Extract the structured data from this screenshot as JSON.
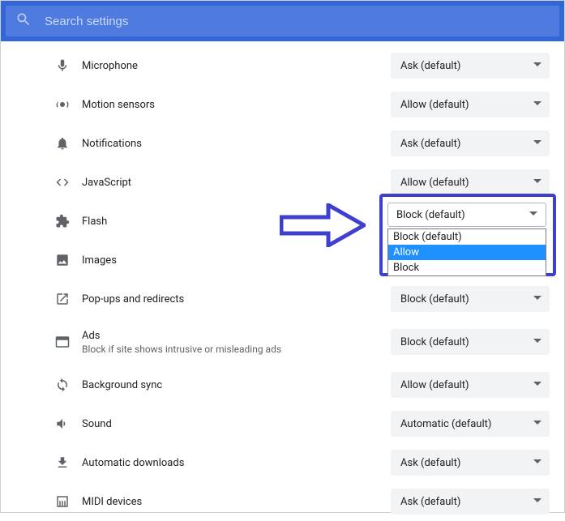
{
  "search": {
    "placeholder": "Search settings"
  },
  "rows": {
    "microphone": {
      "label": "Microphone",
      "value": "Ask (default)"
    },
    "motion": {
      "label": "Motion sensors",
      "value": "Allow (default)"
    },
    "notifications": {
      "label": "Notifications",
      "value": "Ask (default)"
    },
    "javascript": {
      "label": "JavaScript",
      "value": "Allow (default)"
    },
    "flash": {
      "label": "Flash",
      "value": "Block (default)"
    },
    "images": {
      "label": "Images"
    },
    "popups": {
      "label": "Pop-ups and redirects",
      "value": "Block (default)"
    },
    "ads": {
      "label": "Ads",
      "sub": "Block if site shows intrusive or misleading ads",
      "value": "Block (default)"
    },
    "bgsync": {
      "label": "Background sync",
      "value": "Allow (default)"
    },
    "sound": {
      "label": "Sound",
      "value": "Automatic (default)"
    },
    "autodl": {
      "label": "Automatic downloads",
      "value": "Ask (default)"
    },
    "midi": {
      "label": "MIDI devices",
      "value": "Ask (default)"
    }
  },
  "flash_menu": {
    "selected": "Block (default)",
    "options": [
      "Block (default)",
      "Allow",
      "Block"
    ],
    "highlighted_index": 1
  }
}
